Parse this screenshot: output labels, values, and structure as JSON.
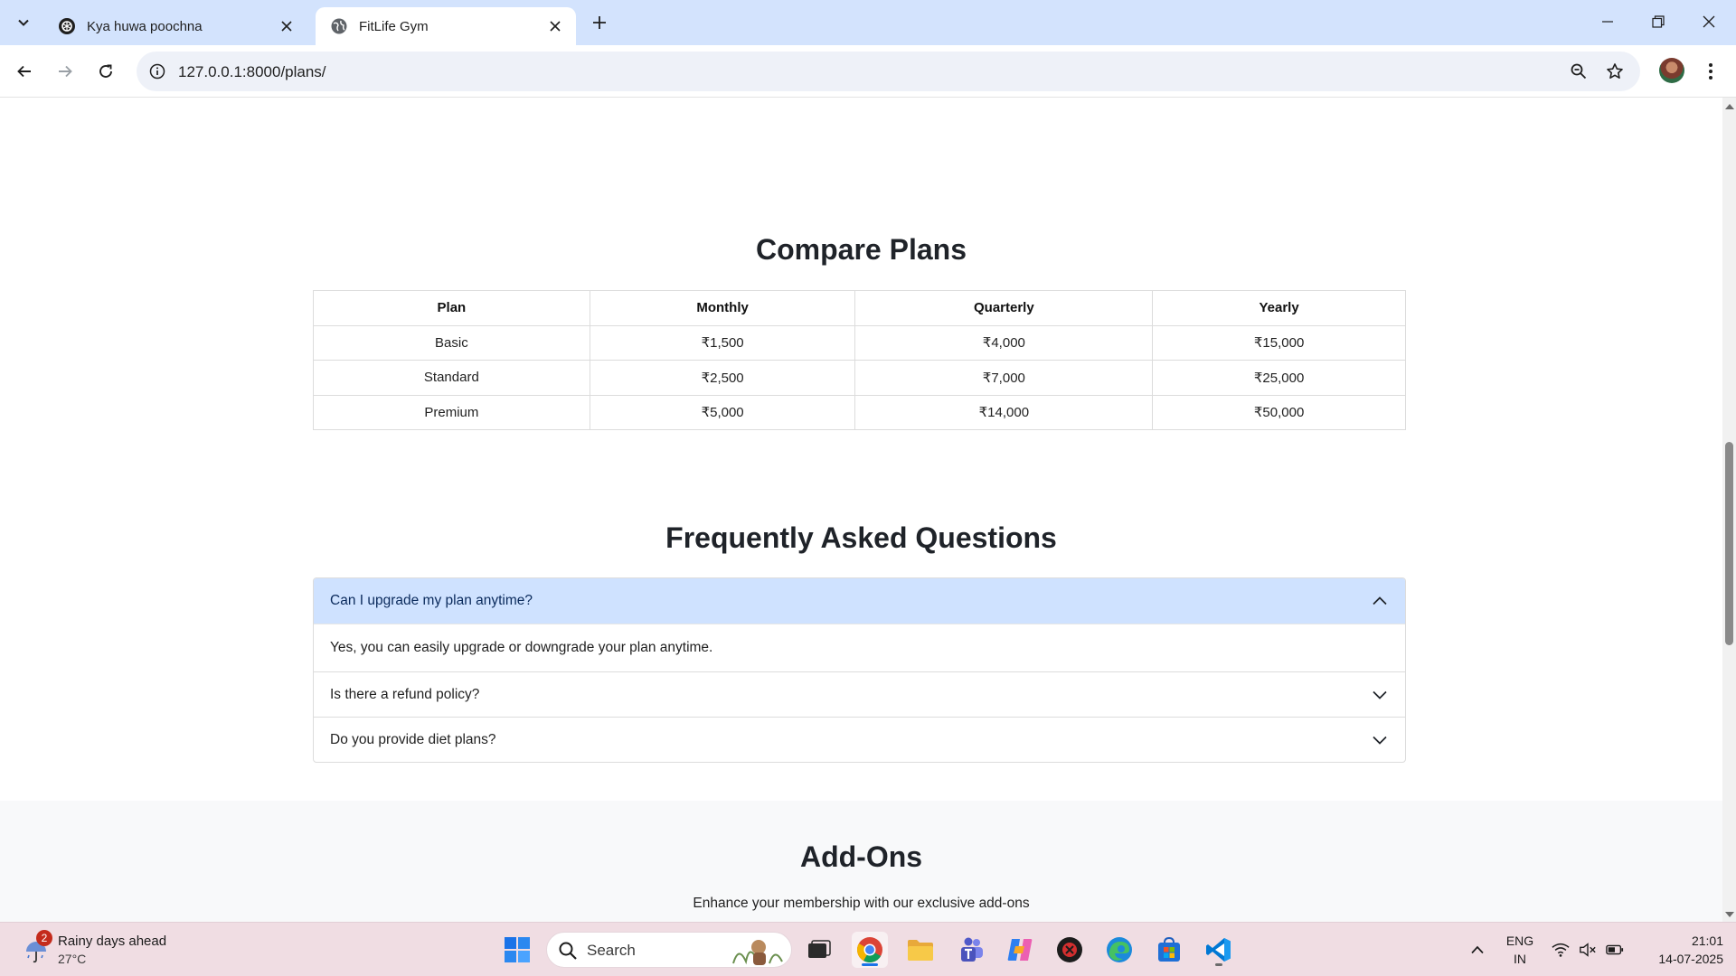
{
  "browser": {
    "tabs": [
      {
        "title": "Kya huwa poochna",
        "active": false,
        "icon": "chatgpt-icon"
      },
      {
        "title": "FitLife Gym",
        "active": true,
        "icon": "globe-icon"
      }
    ],
    "url": "127.0.0.1:8000/plans/"
  },
  "compare": {
    "title": "Compare Plans",
    "headers": [
      "Plan",
      "Monthly",
      "Quarterly",
      "Yearly"
    ],
    "rows": [
      [
        "Basic",
        "₹1,500",
        "₹4,000",
        "₹15,000"
      ],
      [
        "Standard",
        "₹2,500",
        "₹7,000",
        "₹25,000"
      ],
      [
        "Premium",
        "₹5,000",
        "₹14,000",
        "₹50,000"
      ]
    ]
  },
  "faq": {
    "title": "Frequently Asked Questions",
    "items": [
      {
        "question": "Can I upgrade my plan anytime?",
        "answer": "Yes, you can easily upgrade or downgrade your plan anytime.",
        "open": true
      },
      {
        "question": "Is there a refund policy?",
        "open": false
      },
      {
        "question": "Do you provide diet plans?",
        "open": false
      }
    ]
  },
  "addons": {
    "title": "Add-Ons",
    "subtitle": "Enhance your membership with our exclusive add-ons"
  },
  "taskbar": {
    "weather": {
      "badge": "2",
      "headline": "Rainy days ahead",
      "temp": "27°C"
    },
    "search_placeholder": "Search",
    "language": {
      "line1": "ENG",
      "line2": "IN"
    },
    "time": "21:01",
    "date": "14-07-2025",
    "apps": [
      "start-icon",
      "task-view-icon",
      "chrome-icon",
      "file-explorer-icon",
      "teams-icon",
      "copilot-icon",
      "antivirus-icon",
      "edge-icon",
      "store-icon",
      "vscode-icon"
    ]
  },
  "colors": {
    "tabstrip": "#d3e3fd",
    "accordion_open": "#cfe2ff",
    "taskbar": "#f0dde3"
  }
}
